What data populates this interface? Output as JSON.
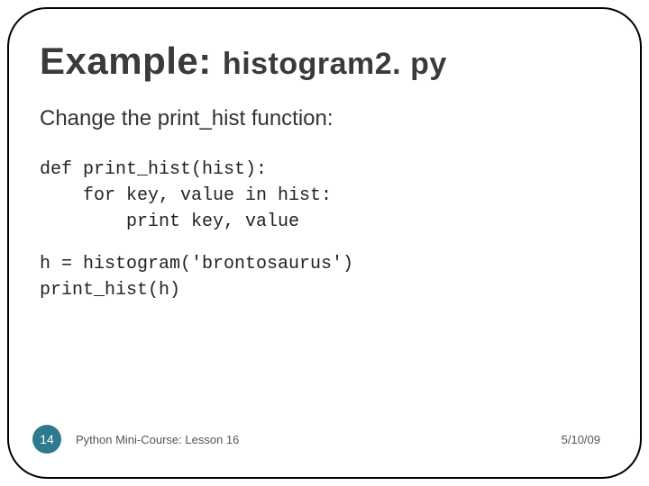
{
  "title": {
    "prefix": "Example: ",
    "filename": "histogram2. py"
  },
  "subhead": "Change the print_hist function:",
  "code": {
    "block1_line1": "def print_hist(hist):",
    "block1_line2": "    for key, value in hist:",
    "block1_line3": "        print key, value",
    "block2_line1": "h = histogram('brontosaurus')",
    "block2_line2": "print_hist(h)"
  },
  "footer": {
    "slide_number": "14",
    "course": "Python Mini-Course: Lesson 16",
    "date": "5/10/09"
  }
}
